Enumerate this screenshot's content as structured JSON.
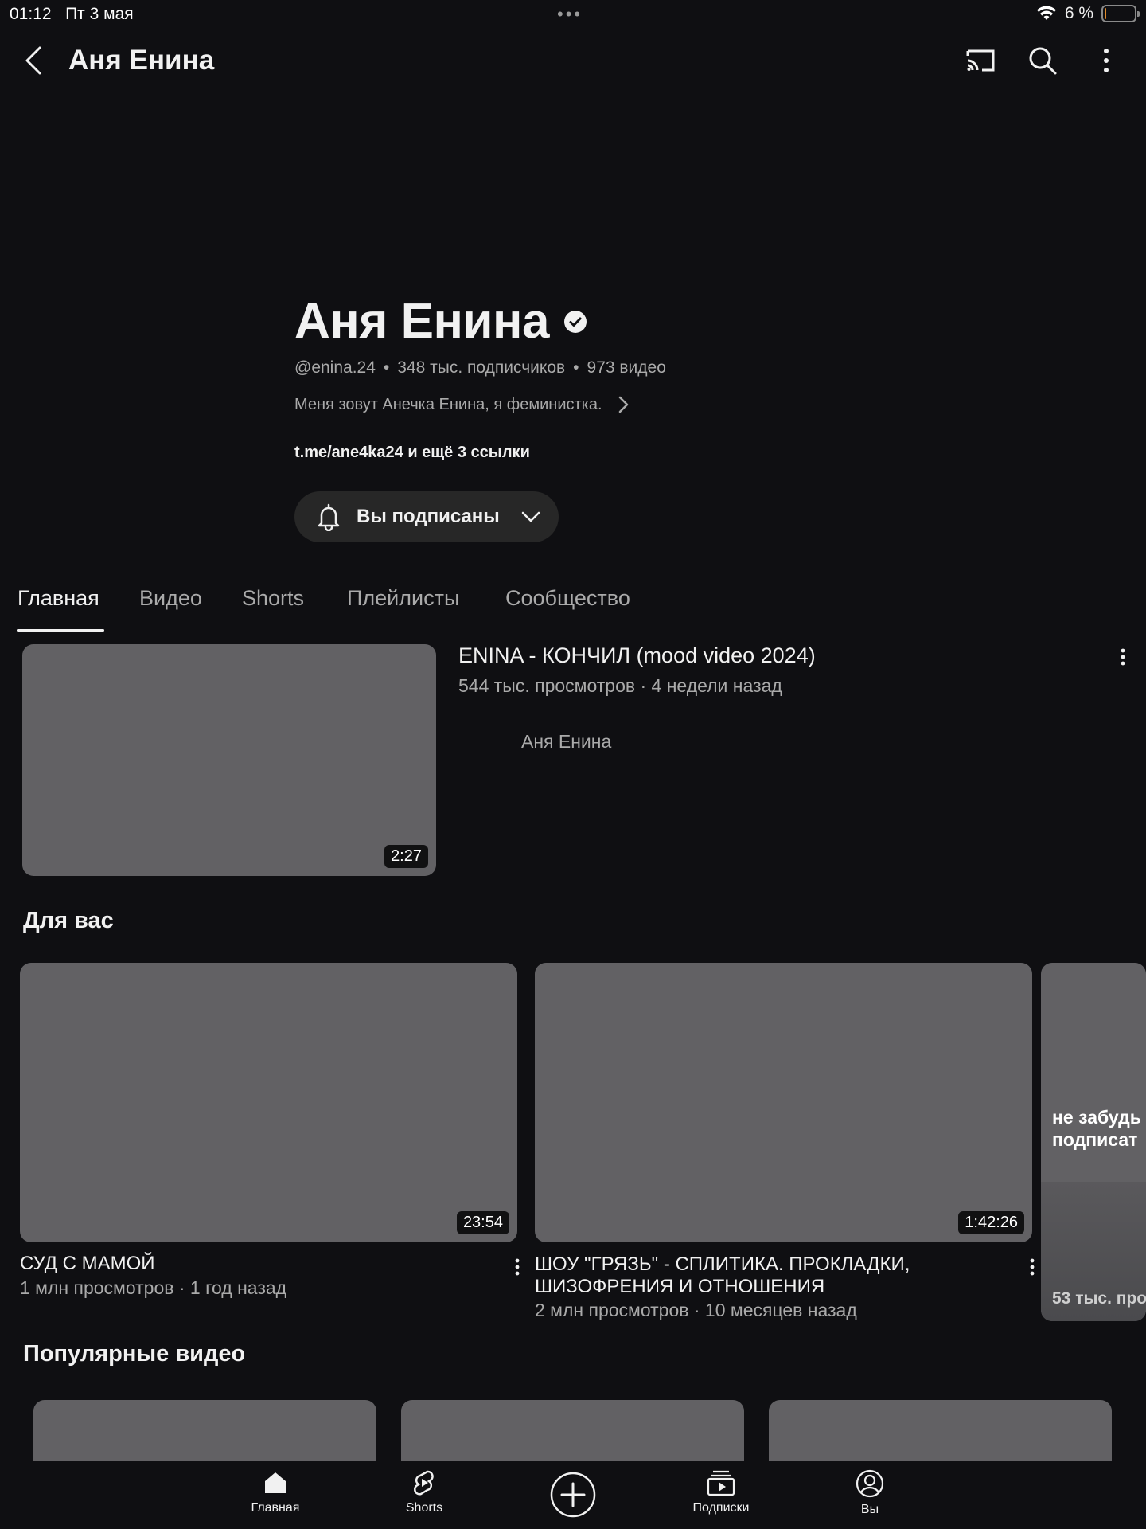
{
  "status_bar": {
    "time": "01:12",
    "date": "Пт 3 мая",
    "battery_text": "6 %",
    "battery_level": 0.06
  },
  "top_bar": {
    "title": "Аня Енина"
  },
  "channel": {
    "name": "Аня Енина",
    "handle": "@enina.24",
    "subscribers": "348 тыс. подписчиков",
    "videos": "973 видео",
    "meta_sep": "•",
    "description": "Меня зовут Анечка Енина, я феминистка.",
    "links": "t.me/ane4ka24 и ещё 3 ссылки",
    "subscribe_label": "Вы подписаны"
  },
  "tabs": [
    {
      "label": "Главная",
      "active": true
    },
    {
      "label": "Видео"
    },
    {
      "label": "Shorts"
    },
    {
      "label": "Плейлисты"
    },
    {
      "label": "Сообщество"
    }
  ],
  "featured": {
    "title": "ENINA - КОНЧИЛ (mood video 2024)",
    "meta": "544 тыс. просмотров · 4 недели назад",
    "author": "Аня Енина",
    "duration": "2:27"
  },
  "for_you": {
    "title": "Для вас",
    "videos": [
      {
        "title": "СУД С МАМОЙ",
        "meta": "1 млн просмотров · 1 год назад",
        "duration": "23:54"
      },
      {
        "title_line1": "ШОУ  \"ГРЯЗЬ\" - СПЛИТИКА. ПРОКЛАДКИ,",
        "title_line2": "ШИЗОФРЕНИЯ И ОТНОШЕНИЯ",
        "meta": "2 млн просмотров · 10 месяцев назад",
        "duration": "1:42:26"
      }
    ],
    "peek": {
      "line1": "не забудь",
      "line2": "подписат",
      "meta": "53 тыс. про"
    }
  },
  "popular": {
    "title": "Популярные видео"
  },
  "bottom_nav": [
    {
      "label": "Главная",
      "icon": "home-icon"
    },
    {
      "label": "Shorts",
      "icon": "shorts-icon"
    },
    {
      "label": "",
      "icon": "create-icon"
    },
    {
      "label": "Подписки",
      "icon": "subscriptions-icon"
    },
    {
      "label": "Вы",
      "icon": "account-icon"
    }
  ]
}
